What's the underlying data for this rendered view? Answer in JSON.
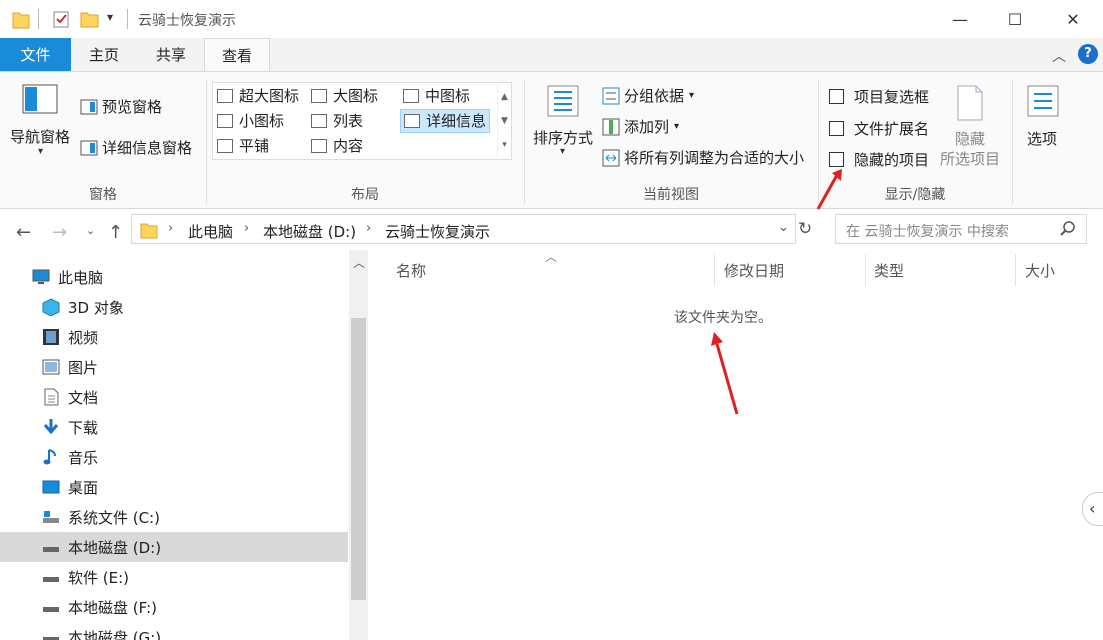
{
  "window": {
    "title": "云骑士恢复演示",
    "controls": {
      "minimize": "—",
      "maximize": "☐",
      "close": "✕"
    }
  },
  "tabs": {
    "file": "文件",
    "home": "主页",
    "share": "共享",
    "view": "查看"
  },
  "ribbon": {
    "panes": {
      "nav_pane": "导航窗格",
      "preview_pane": "预览窗格",
      "details_pane": "详细信息窗格",
      "label": "窗格"
    },
    "layout": {
      "items": [
        "超大图标",
        "大图标",
        "中图标",
        "小图标",
        "列表",
        "详细信息",
        "平铺",
        "内容"
      ],
      "selected": "详细信息",
      "label": "布局"
    },
    "current_view": {
      "sort": "排序方式",
      "group_by": "分组依据",
      "add_column": "添加列",
      "fit_columns": "将所有列调整为合适的大小",
      "label": "当前视图"
    },
    "show_hide": {
      "item_checkboxes": "项目复选框",
      "file_extensions": "文件扩展名",
      "hidden_items": "隐藏的项目",
      "hide_selected_1": "隐藏",
      "hide_selected_2": "所选项目",
      "label": "显示/隐藏"
    },
    "options": "选项"
  },
  "address": {
    "parts": [
      "此电脑",
      "本地磁盘 (D:)",
      "云骑士恢复演示"
    ],
    "search_placeholder": "在 云骑士恢复演示 中搜索"
  },
  "nav": {
    "items": [
      {
        "label": "此电脑",
        "icon": "computer-icon"
      },
      {
        "label": "3D 对象",
        "icon": "3d-objects-icon"
      },
      {
        "label": "视频",
        "icon": "video-icon"
      },
      {
        "label": "图片",
        "icon": "pictures-icon"
      },
      {
        "label": "文档",
        "icon": "documents-icon"
      },
      {
        "label": "下载",
        "icon": "download-icon"
      },
      {
        "label": "音乐",
        "icon": "music-icon"
      },
      {
        "label": "桌面",
        "icon": "desktop-icon"
      },
      {
        "label": "系统文件 (C:)",
        "icon": "system-drive-icon"
      },
      {
        "label": "本地磁盘 (D:)",
        "icon": "drive-icon"
      },
      {
        "label": "软件 (E:)",
        "icon": "drive-icon"
      },
      {
        "label": "本地磁盘 (F:)",
        "icon": "drive-icon"
      },
      {
        "label": "本地磁盘 (G:)",
        "icon": "drive-icon"
      }
    ],
    "selected": "本地磁盘 (D:)"
  },
  "content": {
    "columns": [
      "名称",
      "修改日期",
      "类型",
      "大小"
    ],
    "empty_message": "该文件夹为空。"
  },
  "colors": {
    "accent": "#1a8bd8",
    "annotation": "#e02020",
    "selection": "#cce8ff"
  }
}
